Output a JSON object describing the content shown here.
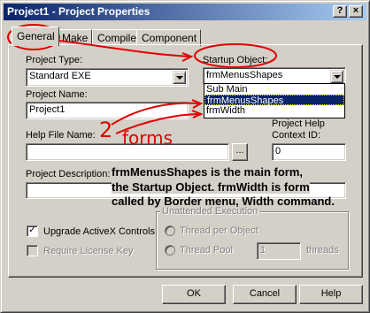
{
  "window": {
    "title": "Project1 - Project Properties",
    "controls": {
      "help": "?",
      "close": "×"
    }
  },
  "tabs": [
    "General",
    "Make",
    "Compile",
    "Component"
  ],
  "general": {
    "project_type_label": "Project Type:",
    "project_type_value": "Standard EXE",
    "startup_object_label": "Startup Object:",
    "startup_object_value": "frmMenusShapes",
    "startup_options": [
      "Sub Main",
      "frmMenusShapes",
      "frmWidth"
    ],
    "project_name_label": "Project Name:",
    "project_name_value": "Project1",
    "help_file_label": "Help File Name:",
    "help_file_value": "",
    "browse_label": "...",
    "help_context_label_1": "Project Help",
    "help_context_label_2": "Context ID:",
    "help_context_value": "0",
    "description_label": "Project Description:",
    "description_value": "",
    "upgrade_activex_label": "Upgrade ActiveX Controls",
    "upgrade_activex_checked": true,
    "require_license_label": "Require License Key",
    "require_license_checked": false,
    "unattended_label": "Unattended Execution",
    "thread_per_object_label": "Thread per Object",
    "thread_pool_label": "Thread Pool",
    "thread_pool_value": "1",
    "threads_label": "threads"
  },
  "buttons": {
    "ok": "OK",
    "cancel": "Cancel",
    "help": "Help"
  },
  "annotations": {
    "forms_count": "2",
    "forms_word": "forms",
    "note_line_1": "frmMenusShapes is the main form,",
    "note_line_2": "the Startup Object. frmWidth is  form",
    "note_line_3": "called by  Border menu, Width command."
  },
  "colors": {
    "titlebar_start": "#0a246a",
    "titlebar_end": "#a6caf0",
    "face": "#d4d0c8",
    "selection": "#0a246a",
    "annotation_red": "#e00000"
  }
}
